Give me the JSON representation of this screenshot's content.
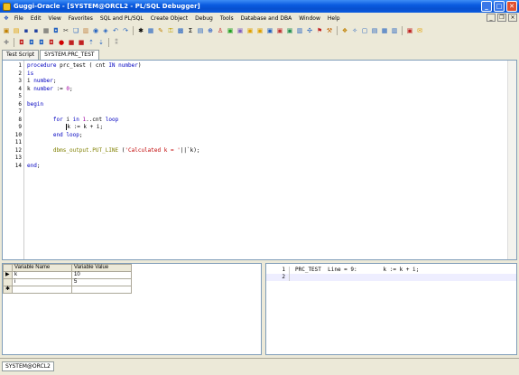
{
  "window": {
    "title": "Guggi-Oracle - [SYSTEM@ORCL2 - PL/SQL Debugger]"
  },
  "menu": [
    "File",
    "Edit",
    "View",
    "Favorites",
    "SQL and PL/SQL",
    "Create Object",
    "Debug",
    "Tools",
    "Database and DBA",
    "Window",
    "Help"
  ],
  "tabs": [
    {
      "label": "Test Script"
    },
    {
      "label": "SYSTEM.PRC_TEST"
    }
  ],
  "editor": {
    "lines": [
      {
        "n": "1",
        "text": "procedure prc_test ( cnt IN number)"
      },
      {
        "n": "2",
        "text": "is"
      },
      {
        "n": "3",
        "text": "i number;"
      },
      {
        "n": "4",
        "text": "k number := 0;"
      },
      {
        "n": "5",
        "text": ""
      },
      {
        "n": "6",
        "text": "begin"
      },
      {
        "n": "7",
        "text": ""
      },
      {
        "n": "8",
        "text": "        for i in 1..cnt loop"
      },
      {
        "n": "9",
        "text": "            k := k + i;"
      },
      {
        "n": "10",
        "text": "        end loop;"
      },
      {
        "n": "11",
        "text": ""
      },
      {
        "n": "12",
        "text": "        dbms_output.PUT_LINE ('Calculated k = '||`k);"
      },
      {
        "n": "13",
        "text": ""
      },
      {
        "n": "14",
        "text": "end;"
      }
    ]
  },
  "variables": {
    "headers": [
      "Variable Name",
      "Variable Value"
    ],
    "rows": [
      {
        "name": "k",
        "value": "10"
      },
      {
        "name": "i",
        "value": "5"
      }
    ]
  },
  "output": {
    "lines": [
      {
        "n": "1",
        "text": "PRC_TEST  Line = 9:        k := k + i;"
      },
      {
        "n": "2",
        "text": ""
      }
    ]
  },
  "status": {
    "connection": "SYSTEM@ORCL2"
  },
  "colors": {
    "titlebar": "#0a5be0",
    "keyword": "#0000c0",
    "number": "#a000a0",
    "string": "#c00000",
    "function": "#808000"
  }
}
